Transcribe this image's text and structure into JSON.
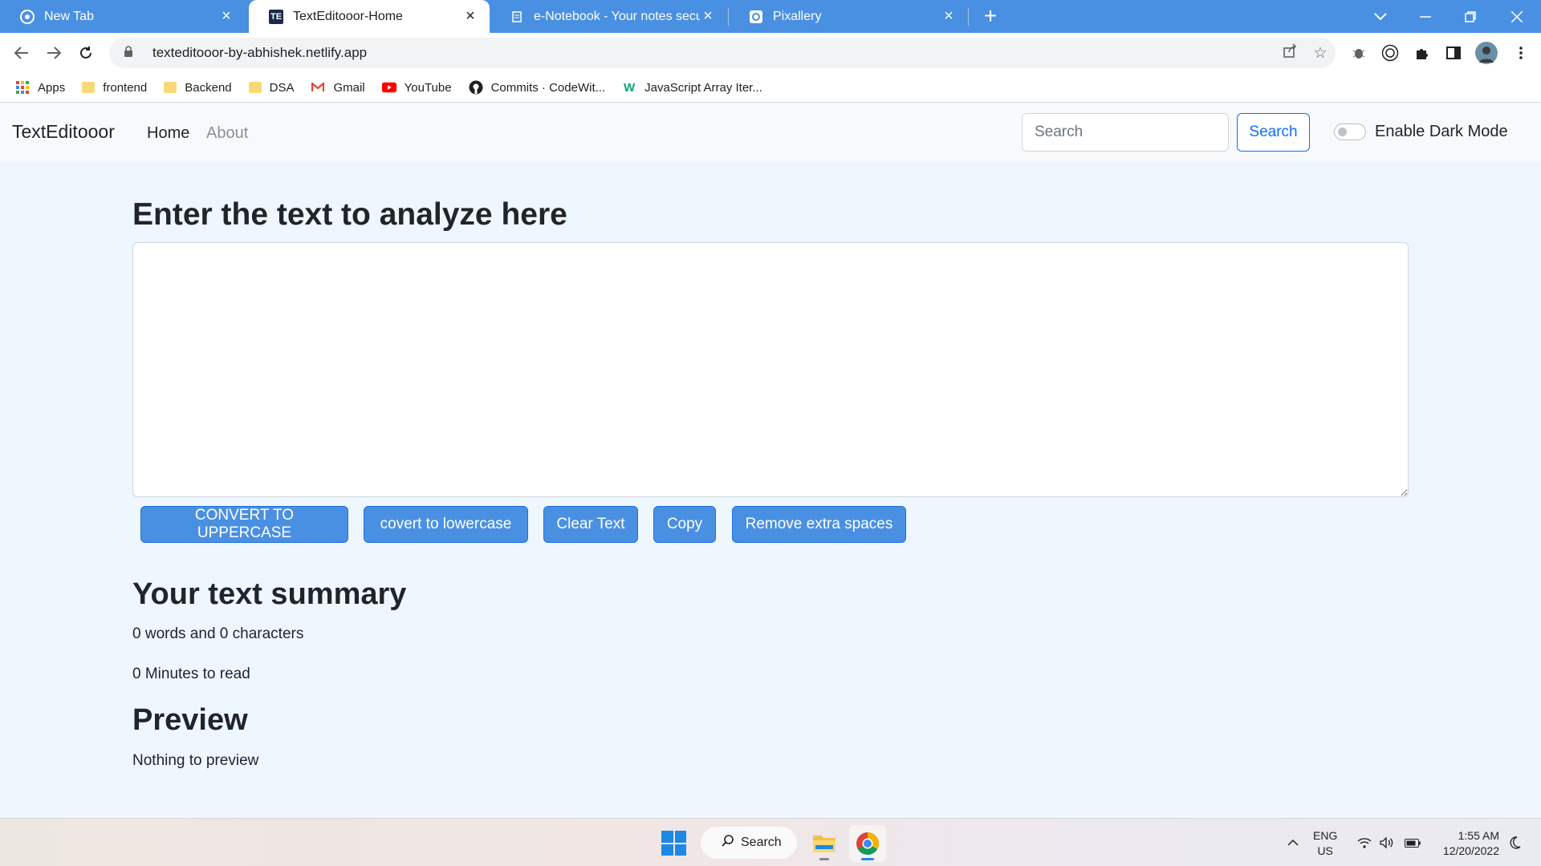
{
  "browser": {
    "tabs": [
      {
        "title": "New Tab",
        "active": false
      },
      {
        "title": "TextEditooor-Home",
        "favicon_text": "TE",
        "active": true
      },
      {
        "title": "e-Notebook - Your notes secured",
        "active": false
      },
      {
        "title": "Pixallery",
        "active": false
      }
    ],
    "url": "texteditooor-by-abhishek.netlify.app",
    "bookmarks": [
      {
        "label": "Apps",
        "icon": "apps-grid-icon"
      },
      {
        "label": "frontend",
        "icon": "folder-icon"
      },
      {
        "label": "Backend",
        "icon": "folder-icon"
      },
      {
        "label": "DSA",
        "icon": "folder-icon"
      },
      {
        "label": "Gmail",
        "icon": "gmail-icon"
      },
      {
        "label": "YouTube",
        "icon": "youtube-icon"
      },
      {
        "label": "Commits · CodeWit...",
        "icon": "github-icon"
      },
      {
        "label": "JavaScript Array Iter...",
        "icon": "w3schools-icon"
      }
    ]
  },
  "navbar": {
    "brand": "TextEditooor",
    "links": [
      {
        "label": "Home",
        "active": true
      },
      {
        "label": "About",
        "active": false
      }
    ],
    "search_placeholder": "Search",
    "search_button": "Search",
    "dark_mode_label": "Enable Dark Mode",
    "dark_mode_enabled": false
  },
  "main": {
    "heading": "Enter the text to analyze here",
    "textarea_value": "",
    "buttons": [
      {
        "label": "CONVERT TO UPPERCASE"
      },
      {
        "label": "covert to lowercase"
      },
      {
        "label": "Clear Text"
      },
      {
        "label": "Copy"
      },
      {
        "label": "Remove extra spaces"
      }
    ],
    "summary_heading": "Your text summary",
    "word_char_count": "0 words and 0 characters",
    "read_time": "0 Minutes to read",
    "preview_heading": "Preview",
    "preview_text": "Nothing to preview"
  },
  "taskbar": {
    "search_label": "Search",
    "language": "ENG",
    "region": "US",
    "time": "1:55 AM",
    "date": "12/20/2022"
  },
  "colors": {
    "tabstrip": "#4a90e2",
    "page_background": "#eff7fe",
    "button_primary": "#4a90e2",
    "search_button_border": "#0d6efd"
  }
}
